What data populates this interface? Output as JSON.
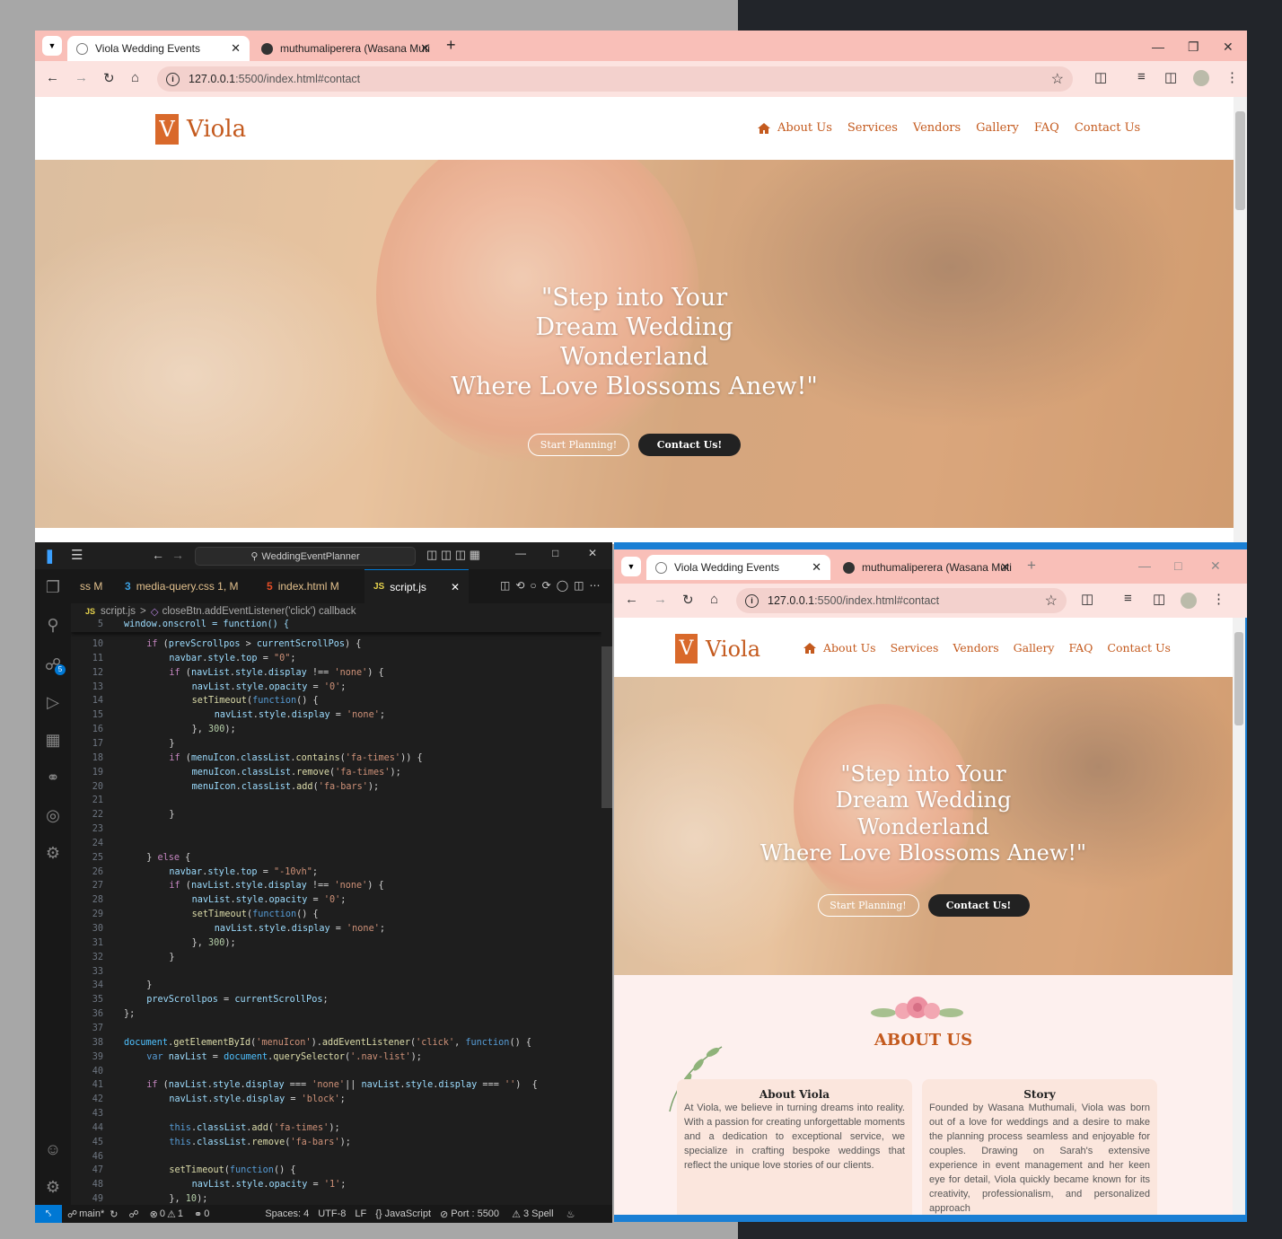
{
  "browser": {
    "tabs": [
      {
        "title": "Viola Wedding Events",
        "active": true
      },
      {
        "title": "muthumaliperera (Wasana Muti",
        "active": false
      }
    ],
    "new_tab": "+",
    "url_host": "127.0.0.1",
    "url_rest": ":5500/index.html#contact"
  },
  "site": {
    "brand_letter": "V",
    "brand_name": "Viola",
    "nav": [
      "About Us",
      "Services",
      "Vendors",
      "Gallery",
      "FAQ",
      "Contact Us"
    ],
    "headline": [
      "\"Step into Your",
      "Dream Wedding",
      "Wonderland",
      "Where Love Blossoms Anew!\""
    ],
    "btn_primary": "Start Planning!",
    "btn_secondary": "Contact Us!",
    "about_title": "ABOUT US",
    "card1_title": "About Viola",
    "card1_text": "At Viola, we believe in turning dreams into reality. With a passion for creating unforgettable moments and a dedication to exceptional service, we specialize in crafting bespoke weddings that reflect the unique love stories of our clients.",
    "card2_title": "Story",
    "card2_text": "Founded by Wasana Muthumali, Viola was born out of a love for weddings and a desire to make the planning process seamless and enjoyable for couples. Drawing on Sarah's extensive experience in event management and her keen eye for detail, Viola quickly became known for its creativity, professionalism, and personalized approach"
  },
  "vscode": {
    "search": "WeddingEventPlanner",
    "tabs": [
      "ss M",
      "media-query.css 1, M",
      "index.html M",
      "script.js"
    ],
    "breadcrumb_file": "script.js",
    "breadcrumb_sep": ">",
    "breadcrumb_symbol": "closeBtn.addEventListener('click') callback",
    "sticky_line_no": "5",
    "sticky_line": "window.onscroll = function() {",
    "status_branch": "main*",
    "status_errors": "0",
    "status_warnings": "1",
    "status_ports": "0",
    "status_spaces": "Spaces: 4",
    "status_encoding": "UTF-8",
    "status_eol": "LF",
    "status_lang": "{} JavaScript",
    "status_port": "Port : 5500",
    "status_spell": "3 Spell",
    "scm_badge": "5"
  }
}
